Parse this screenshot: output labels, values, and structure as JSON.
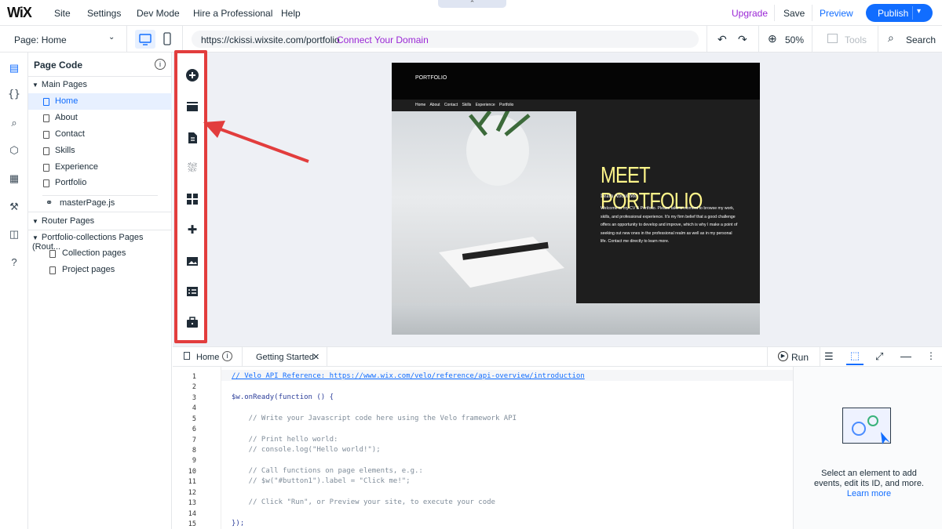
{
  "topbar": {
    "logo": "WiX",
    "menu": [
      "Site",
      "Settings",
      "Dev Mode",
      "Hire a Professional",
      "Help"
    ],
    "upgrade": "Upgrade",
    "save": "Save",
    "preview": "Preview",
    "publish": "Publish"
  },
  "bar2": {
    "page_select": "Page: Home",
    "url": "https://ckissi.wixsite.com/portfolio",
    "connect_domain": "Connect Your Domain",
    "zoom": "50%",
    "tools": "Tools",
    "search": "Search"
  },
  "panel": {
    "title": "Page Code",
    "main_pages_label": "Main Pages",
    "main_pages": [
      "Home",
      "About",
      "Contact",
      "Skills",
      "Experience",
      "Portfolio"
    ],
    "master": "masterPage.js",
    "router_label": "Router Pages",
    "router_group": "Portfolio-collections Pages (Rout...",
    "router_pages": [
      "Collection pages",
      "Project pages"
    ]
  },
  "site": {
    "logo": "PORTFOLIO",
    "nav": "Home About Contact Skills Experience Portfolio",
    "headline": "MEET PORTFOLIO",
    "subhead": "Learn About Me",
    "body": "Welcome to my CV & Portfolio. Please take a moment to browse my work, skills, and professional experience. It's my firm belief that a good challenge offers an opportunity to develop and improve, which is why I make a point of seeking out new ones in the professional realm as well as in my personal life. Contact me directly to learn more."
  },
  "code_panel": {
    "tab_home": "Home",
    "tab_getting_started": "Getting Started",
    "run": "Run",
    "line_numbers": [
      "1",
      "2",
      "3",
      "4",
      "5",
      "6",
      "7",
      "8",
      "9",
      "10",
      "11",
      "12",
      "13",
      "14",
      "15"
    ],
    "lines": [
      "// Velo API Reference: https://www.wix.com/velo/reference/api-overview/introduction",
      "",
      "$w.onReady(function () {",
      "",
      "    // Write your Javascript code here using the Velo framework API",
      "",
      "    // Print hello world:",
      "    // console.log(\"Hello world!\");",
      "",
      "    // Call functions on page elements, e.g.:",
      "    // $w(\"#button1\").label = \"Click me!\";",
      "",
      "    // Click \"Run\", or Preview your site, to execute your code",
      "",
      "});"
    ],
    "help_text": "Select an element to add events, edit its ID, and more.",
    "help_link": "Learn more"
  },
  "colors": {
    "accent": "#116dff",
    "upgrade": "#9a27d5",
    "highlight": "#e23d3d",
    "headline": "#fff58a"
  }
}
